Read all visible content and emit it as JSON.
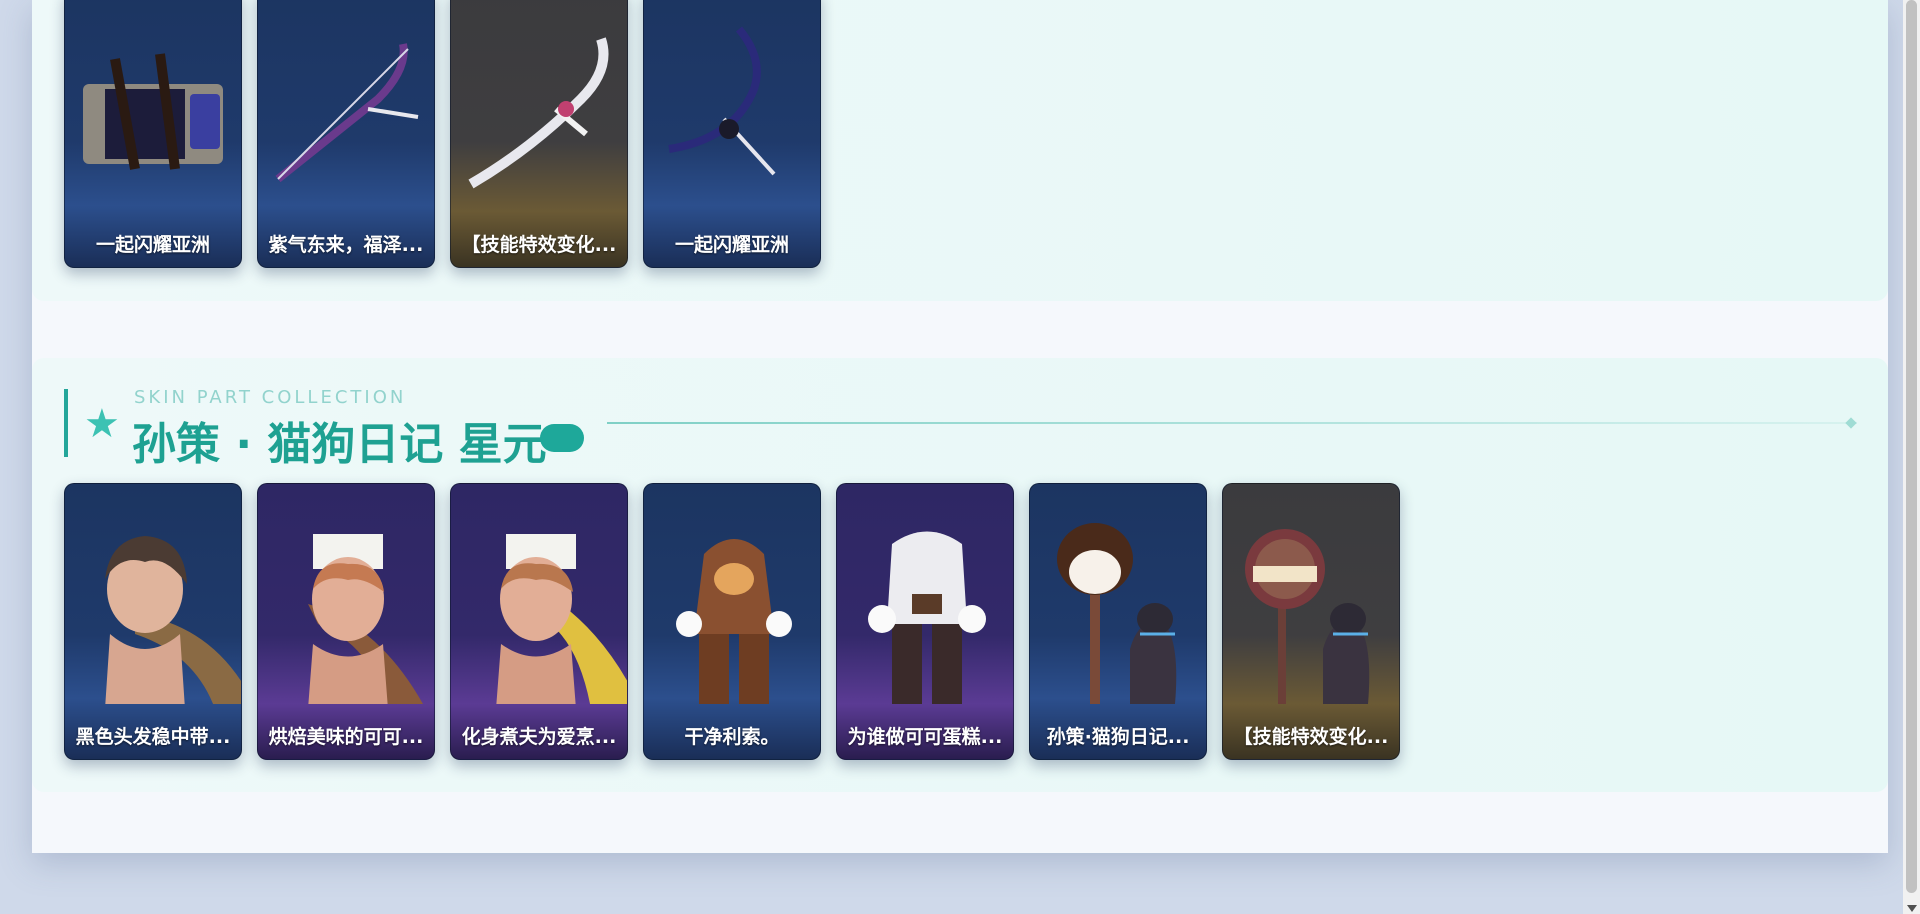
{
  "top_section": {
    "items": [
      {
        "label": "一起闪耀亚洲",
        "tone": "blue",
        "art": "chest"
      },
      {
        "label": "紫气东来，福泽...",
        "tone": "blue",
        "art": "bow-purple"
      },
      {
        "label": "【技能特效变化...",
        "tone": "gray",
        "art": "bow-white"
      },
      {
        "label": "一起闪耀亚洲",
        "tone": "blue",
        "art": "bow-blue"
      }
    ]
  },
  "collection_section": {
    "eyebrow": "SKIN PART COLLECTION",
    "title": "孙策 · 猫狗日记 星元",
    "items": [
      {
        "label": "黑色头发稳中带...",
        "tone": "blue",
        "art": "head-dark"
      },
      {
        "label": "烘焙美味的可可...",
        "tone": "purple",
        "art": "head-hat"
      },
      {
        "label": "化身煮夫为爱烹...",
        "tone": "purple",
        "art": "head-hat-scarf"
      },
      {
        "label": "干净利索。",
        "tone": "blue",
        "art": "outfit-brown"
      },
      {
        "label": "为谁做可可蛋糕...",
        "tone": "purple",
        "art": "outfit-white"
      },
      {
        "label": "孙策·猫狗日记...",
        "tone": "blue",
        "art": "staff-dogs"
      },
      {
        "label": "【技能特效变化...",
        "tone": "gray",
        "art": "sign-dogs"
      }
    ]
  }
}
